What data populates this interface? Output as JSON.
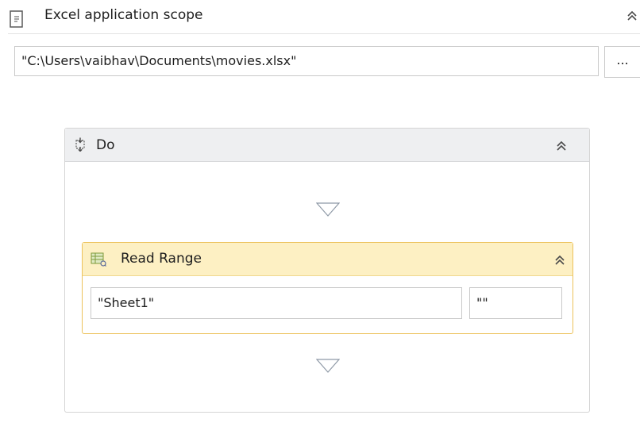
{
  "scope": {
    "title": "Excel application scope",
    "icon": "excel-scope-icon",
    "collapse_icon": "double-chevron-up-icon",
    "workbook_path": "\"C:\\Users\\vaibhav\\Documents\\movies.xlsx\"",
    "browse_label": "..."
  },
  "sequence": {
    "title": "Do",
    "icon": "sequence-icon",
    "collapse_icon": "double-chevron-up-icon",
    "drop_icon": "triangle-down-icon"
  },
  "read_range": {
    "title": "Read Range",
    "icon": "read-range-icon",
    "collapse_icon": "double-chevron-up-icon",
    "sheet_name": "\"Sheet1\"",
    "range": "\"\""
  },
  "colors": {
    "read_range_header": "#fdf0c3",
    "read_range_border": "#ecc25b",
    "do_header": "#eeeff1",
    "input_border": "#c9c9c9"
  }
}
